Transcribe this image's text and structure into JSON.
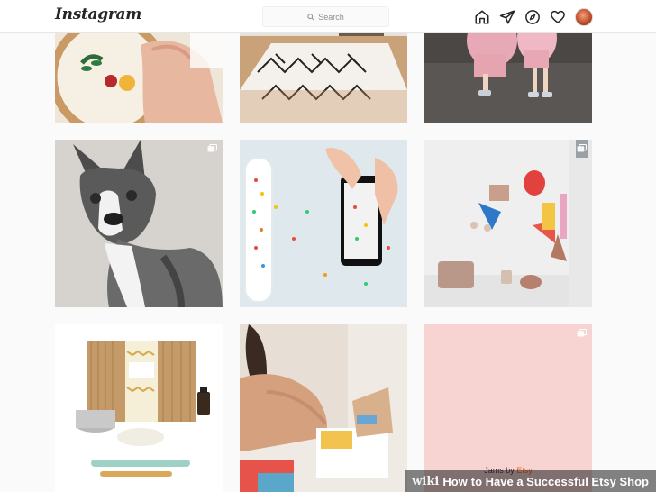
{
  "header": {
    "logo": "Instagram",
    "search_placeholder": "Search",
    "icons": [
      "home-icon",
      "direct-message-icon",
      "explore-icon",
      "activity-heart-icon",
      "profile-avatar"
    ]
  },
  "grid": {
    "posts": [
      {
        "name": "embroidery-hoop"
      },
      {
        "name": "nursery-rug"
      },
      {
        "name": "kids-pink-outfits"
      },
      {
        "name": "dog-portrait",
        "multi": true
      },
      {
        "name": "phone-confetti"
      },
      {
        "name": "craft-wall",
        "multi": true
      },
      {
        "name": "soy-candle-kit"
      },
      {
        "name": "gift-box-unboxing"
      },
      {
        "name": "jams-by-etsy",
        "multi": true,
        "caption_lead": "Jams by ",
        "caption_brand": "Etsy"
      }
    ]
  },
  "watermark": {
    "brand": "wiki",
    "title_bold": "How",
    "title_rest": " to Have a Successful Etsy Shop"
  },
  "colors": {
    "background": "#fafafa",
    "header": "#ffffff",
    "tile_pink": "#f7d3d2",
    "etsy_orange": "#f1641e"
  }
}
